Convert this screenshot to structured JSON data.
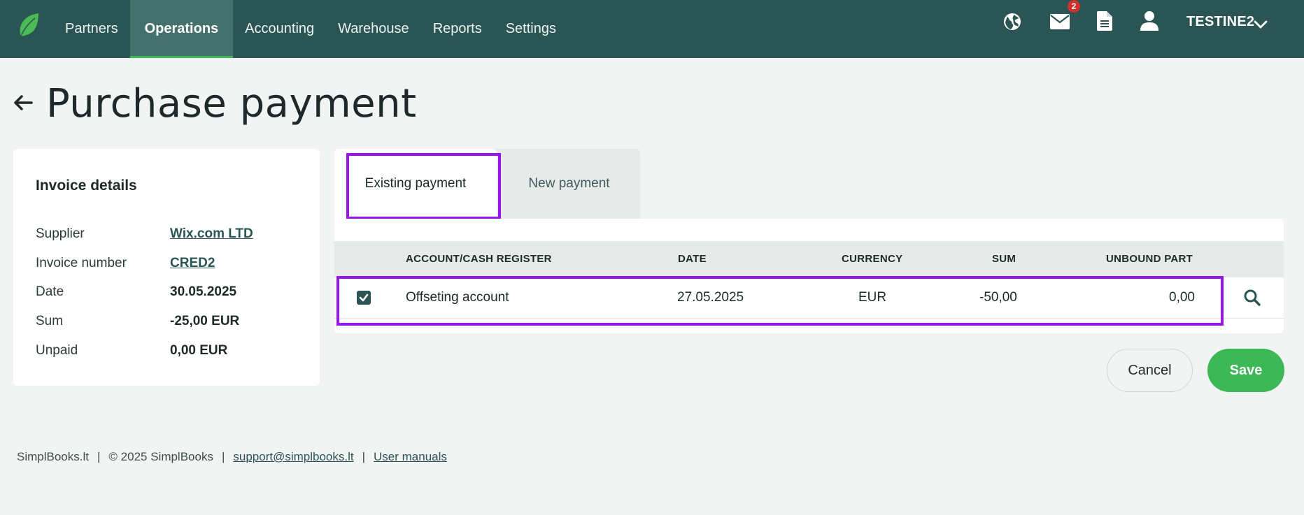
{
  "nav": {
    "items": [
      {
        "label": "Partners",
        "active": false
      },
      {
        "label": "Operations",
        "active": true
      },
      {
        "label": "Accounting",
        "active": false
      },
      {
        "label": "Warehouse",
        "active": false
      },
      {
        "label": "Reports",
        "active": false
      },
      {
        "label": "Settings",
        "active": false
      }
    ],
    "mail_badge": "2",
    "user_name": "TESTINE2",
    "icons": [
      "globe-icon",
      "mail-icon",
      "document-icon",
      "user-icon",
      "chevron-down-icon"
    ]
  },
  "page": {
    "title": "Purchase payment"
  },
  "invoice": {
    "title": "Invoice details",
    "supplier_label": "Supplier",
    "supplier_value": "Wix.com LTD",
    "number_label": "Invoice number",
    "number_value": "CRED2",
    "date_label": "Date",
    "date_value": "30.05.2025",
    "sum_label": "Sum",
    "sum_value": "-25,00 EUR",
    "unpaid_label": "Unpaid",
    "unpaid_value": "0,00 EUR"
  },
  "tabs": {
    "existing": "Existing payment",
    "new": "New payment"
  },
  "table": {
    "headers": {
      "account": "ACCOUNT/CASH REGISTER",
      "date": "DATE",
      "currency": "CURRENCY",
      "sum": "SUM",
      "unbound": "UNBOUND PART"
    },
    "rows": [
      {
        "checked": true,
        "account": "Offseting account",
        "date": "27.05.2025",
        "currency": "EUR",
        "sum": "-50,00",
        "unbound": "0,00"
      }
    ]
  },
  "buttons": {
    "cancel": "Cancel",
    "save": "Save"
  },
  "footer": {
    "site": "SimplBooks.lt",
    "copyright": "© 2025 SimplBooks",
    "email": "support@simplbooks.lt",
    "manuals": "User manuals",
    "separator": "|"
  },
  "colors": {
    "topbar": "#2a5554",
    "accent": "#3db857",
    "highlight": "#9a14f0"
  }
}
